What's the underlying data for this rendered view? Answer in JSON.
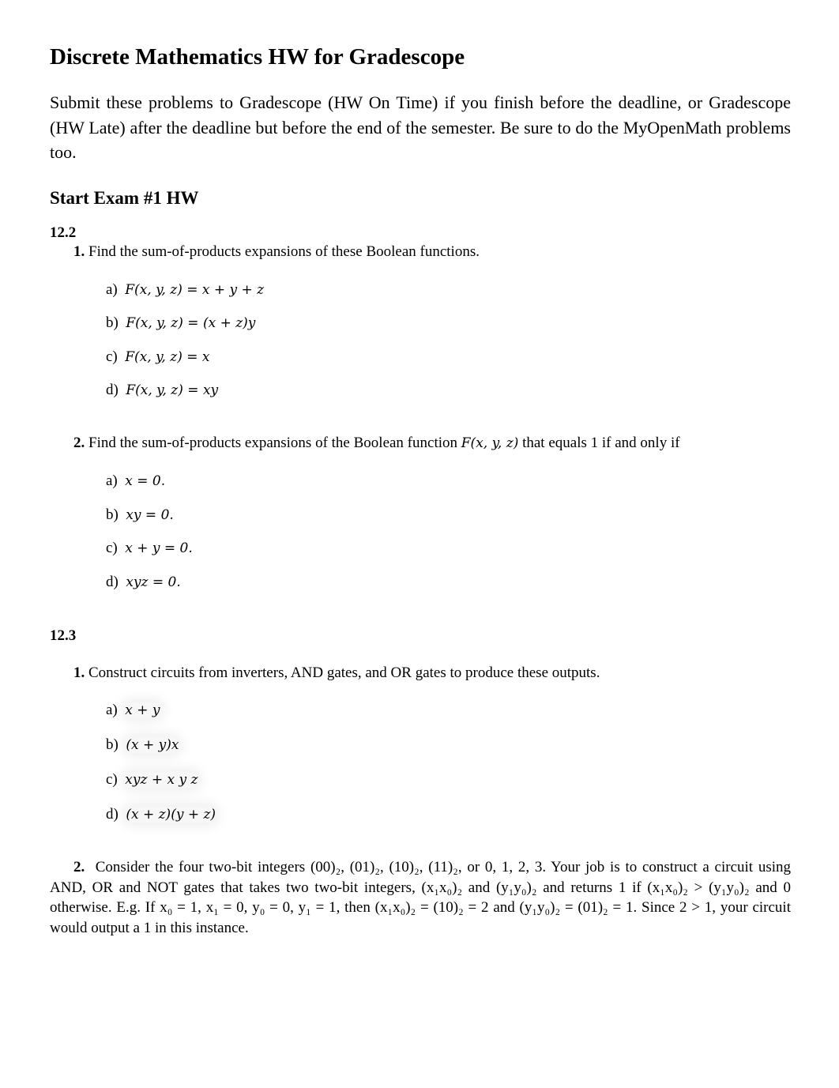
{
  "title": "Discrete Mathematics HW for Gradescope",
  "intro": "Submit these problems to Gradescope (HW On Time) if you finish before the deadline, or Gradescope (HW Late) after the deadline but before the end of the semester. Be sure to do the MyOpenMath problems too.",
  "section_heading": "Start Exam #1 HW",
  "sections": [
    {
      "label": "12.2",
      "problems": [
        {
          "number": "1.",
          "text": "Find the sum-of-products expansions of these Boolean functions.",
          "items": [
            {
              "label": "a)",
              "expr": "F(x, y, z) = x + y + z"
            },
            {
              "label": "b)",
              "expr": "F(x, y, z) = (x + z)y"
            },
            {
              "label": "c)",
              "expr": "F(x, y, z) = x"
            },
            {
              "label": "d)",
              "expr": "F(x, y, z) = xy"
            }
          ]
        },
        {
          "number": "2.",
          "text_before": "Find the sum-of-products expansions of the Boolean function",
          "text_math": "F(x, y, z)",
          "text_after": "that equals 1 if and only if",
          "items": [
            {
              "label": "a)",
              "expr": "x = 0."
            },
            {
              "label": "b)",
              "expr": "xy = 0."
            },
            {
              "label": "c)",
              "expr": "x + y = 0."
            },
            {
              "label": "d)",
              "expr": "xyz = 0."
            }
          ]
        }
      ]
    },
    {
      "label": "12.3",
      "problems": [
        {
          "number": "1.",
          "text": "Construct circuits from inverters, AND gates, and OR gates to produce these outputs.",
          "items": [
            {
              "label": "a)",
              "expr": "x + y"
            },
            {
              "label": "b)",
              "expr": "(x + y)x"
            },
            {
              "label": "c)",
              "expr": "xyz + x y z"
            },
            {
              "label": "d)",
              "expr": "(x + z)(y + z)"
            }
          ]
        },
        {
          "number": "2.",
          "text": "Consider the four two-bit integers (00)₂, (01)₂, (10)₂, (11)₂, or 0, 1, 2, 3. Your job is to construct a circuit using AND, OR and NOT gates that takes two two-bit integers, (x₁x₀)₂ and (y₁y₀)₂ and returns 1 if (x₁x₀)₂ > (y₁y₀)₂ and 0 otherwise. E.g. If x₀ = 1, x₁ = 0, y₀ = 0, y₁ = 1, then (x₁x₀)₂ = (10)₂ = 2 and (y₁y₀)₂ = (01)₂ = 1. Since 2 > 1, your circuit would output a 1 in this instance."
        }
      ]
    }
  ]
}
